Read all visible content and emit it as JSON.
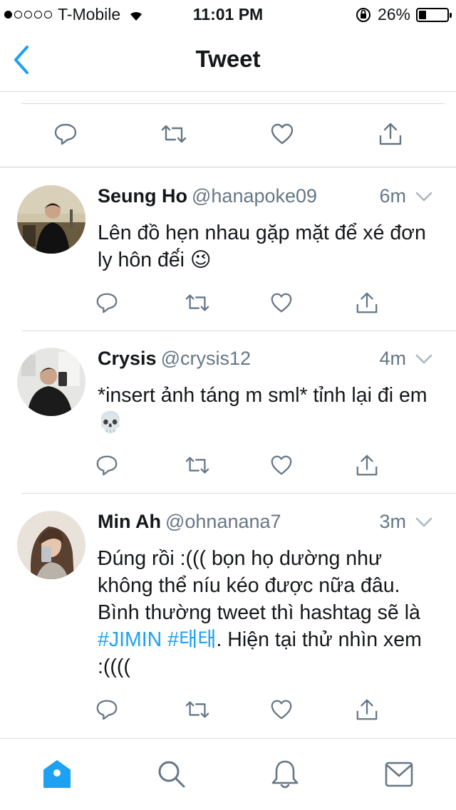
{
  "status_bar": {
    "signal_filled": 1,
    "signal_total": 5,
    "carrier": "T-Mobile",
    "time": "11:01 PM",
    "battery_text": "26%",
    "battery_level": 0.26,
    "icons": [
      "wifi-icon",
      "rotation-lock-icon",
      "battery-icon"
    ]
  },
  "nav": {
    "title": "Tweet",
    "back_icon": "chevron-left-icon",
    "accent": "#1da1f2"
  },
  "actions_icons": [
    "reply-icon",
    "retweet-icon",
    "like-icon",
    "share-icon"
  ],
  "replies": [
    {
      "name": "Seung Ho",
      "handle": "@hanapoke09",
      "time": "6m",
      "text": "Lên đồ hẹn nhau gặp mặt để xé đơn ly hôn đế́i 😉"
    },
    {
      "name": "Crysis",
      "handle": "@crysis12",
      "time": "4m",
      "text": "*insert ảnh táng m sml* tỉnh lại đi em 💀"
    },
    {
      "name": "Min Ah",
      "handle": "@ohnanana7",
      "time": "3m",
      "text_before": "Đúng rồi :((( bọn họ dường như không thể níu kéo được nữa đâu. Bình thường tweet thì hashtag sẽ là ",
      "hashtags": "#JIMIN #태태",
      "text_after": ". Hiện tại thử nhìn xem :(((("
    }
  ],
  "tabbar": {
    "tabs": [
      "home-icon",
      "search-icon",
      "notifications-icon",
      "messages-icon"
    ],
    "active": "home-icon"
  },
  "colors": {
    "accent": "#1da1f2",
    "icon_gray": "#657786",
    "text": "#14171a"
  }
}
